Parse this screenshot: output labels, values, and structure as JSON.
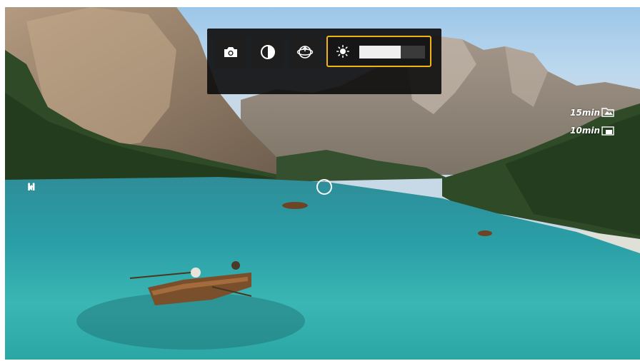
{
  "toolbar": {
    "buttons": [
      {
        "name": "camera-button",
        "icon": "camera-icon"
      },
      {
        "name": "contrast-button",
        "icon": "contrast-icon"
      },
      {
        "name": "sphere-button",
        "icon": "sphere-icon"
      }
    ],
    "brightness": {
      "icon": "sun-icon",
      "level": 0.63
    },
    "accent": "#f2b318"
  },
  "overlay": {
    "video_timer": "15min",
    "photo_timer": "10min",
    "heading_label": "H"
  }
}
